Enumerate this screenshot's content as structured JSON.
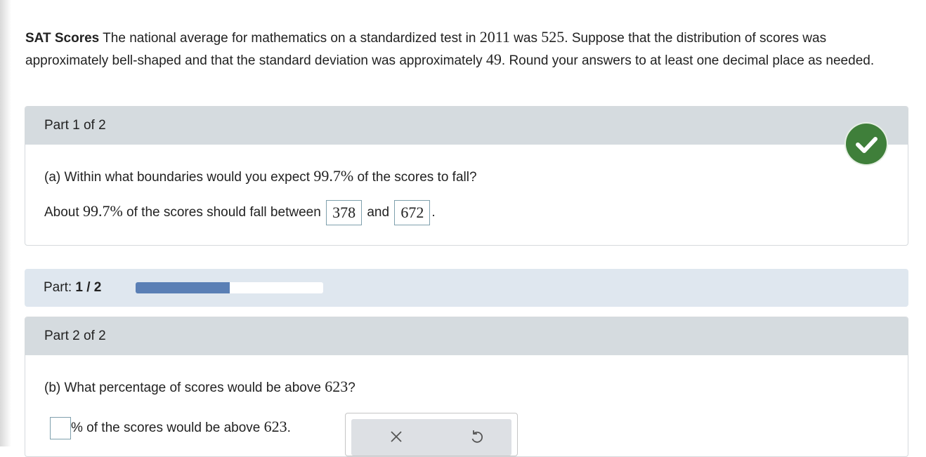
{
  "problem": {
    "title": "SAT Scores",
    "t1": " The national average for mathematics on a standardized test in ",
    "year": "2011",
    "t2": " was ",
    "mean": "525",
    "t3": ". Suppose that the distribution of scores was approximately bell-shaped and that the standard deviation was approximately ",
    "sd": "49",
    "t4": ". Round your answers to at least one decimal place as needed."
  },
  "part1": {
    "header": "Part 1 of 2",
    "q_prefix": "(a) Within what boundaries would you expect ",
    "q_pct": "99.7%",
    "q_suffix": " of the scores to fall?",
    "a_prefix": "About ",
    "a_pct": "99.7%",
    "a_mid": " of the scores should fall between ",
    "lower": "378",
    "and": "and",
    "upper": "672",
    "period": ".",
    "status": "correct",
    "status_icon": "checkmark-icon",
    "status_color": "#3f7f3a"
  },
  "progress": {
    "label": "Part: ",
    "value": "1 / 2",
    "fraction": 0.5,
    "fill_color": "#5a7fb5"
  },
  "part2": {
    "header": "Part 2 of 2",
    "q_prefix": "(b) What percentage of scores would be above ",
    "q_value": "623",
    "q_suffix": "?",
    "a_input_value": "",
    "a_pct": "%",
    "a_mid": " of the scores would be above ",
    "a_value": "623",
    "a_period": "."
  },
  "tools": {
    "clear_icon": "x-icon",
    "undo_icon": "undo-icon"
  }
}
